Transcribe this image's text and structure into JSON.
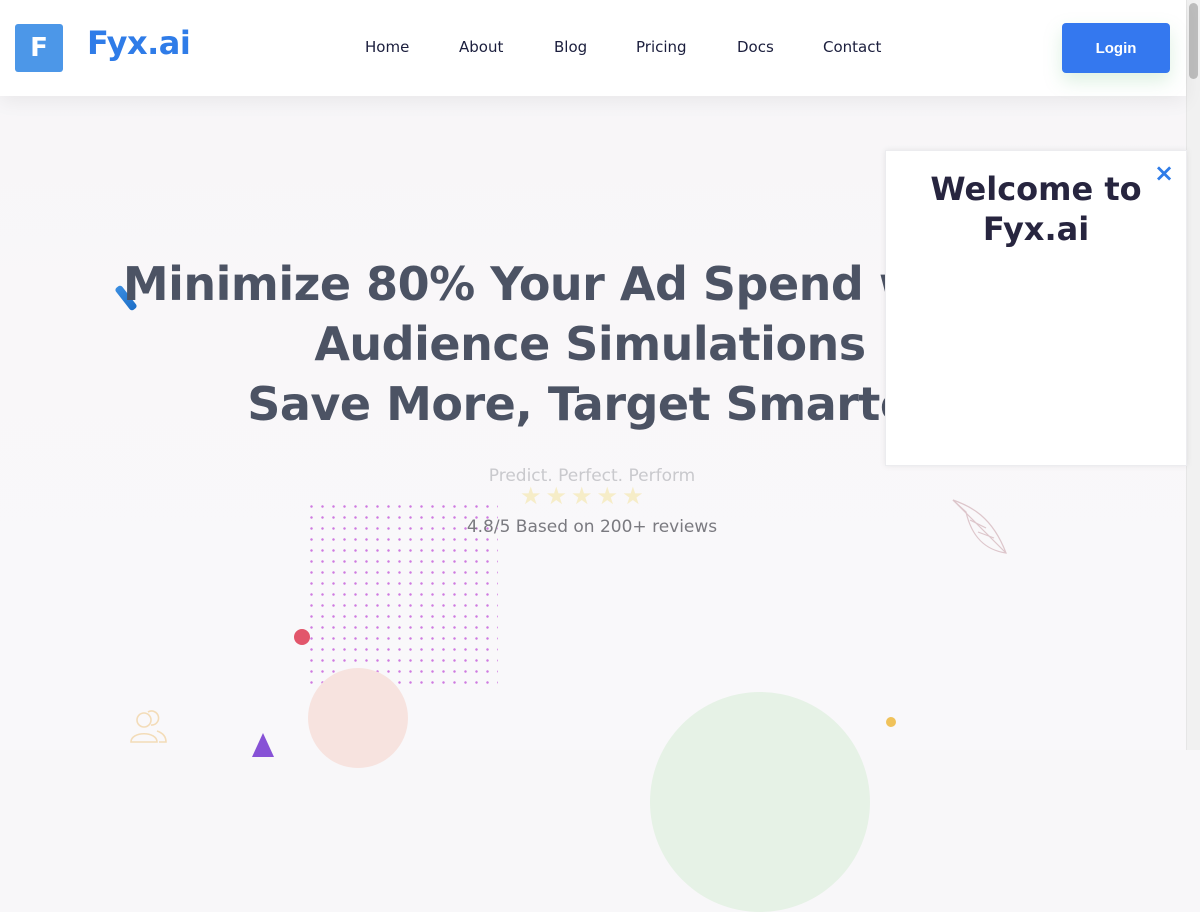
{
  "header": {
    "logo_letter": "F",
    "brand": "Fyx.ai",
    "nav": [
      {
        "label": "Home"
      },
      {
        "label": "About"
      },
      {
        "label": "Blog"
      },
      {
        "label": "Pricing"
      },
      {
        "label": "Docs"
      },
      {
        "label": "Contact"
      }
    ],
    "login_label": "Login"
  },
  "hero": {
    "title_lines": [
      "Minimize 80% Your Ad Spend with AI",
      "Audience Simulations",
      "Save More, Target Smarter"
    ],
    "tagline": "Predict. Perfect. Perform",
    "stars": "★★★★★",
    "rating_value": 4.8,
    "rating_text": "4.8/5 Based on 200+ reviews"
  },
  "modal": {
    "title": "Welcome to Fyx.ai",
    "close_icon": "×"
  },
  "decorations": {
    "icons": [
      "users-icon",
      "leaf-icon",
      "pen-stroke-icon",
      "triangle-shape",
      "dot-grid-pattern"
    ]
  },
  "colors": {
    "brand_blue": "#2f7ce8",
    "login_bg": "#3478ef",
    "logo_box": "#4c97e8",
    "title_text": "#4c5364",
    "modal_title": "#27253f"
  }
}
